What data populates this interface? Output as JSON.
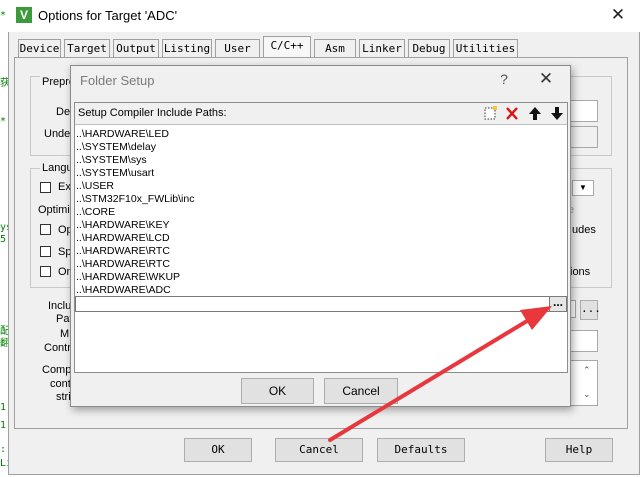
{
  "window": {
    "title": "Options for Target 'ADC'",
    "close_glyph": "✕",
    "icon_letter": "V"
  },
  "tabs": [
    {
      "label": "Device"
    },
    {
      "label": "Target"
    },
    {
      "label": "Output"
    },
    {
      "label": "Listing"
    },
    {
      "label": "User"
    },
    {
      "label": "C/C++"
    },
    {
      "label": "Asm"
    },
    {
      "label": "Linker"
    },
    {
      "label": "Debug"
    },
    {
      "label": "Utilities"
    }
  ],
  "active_tab": "C/C++",
  "background_panel": {
    "preprocessor_label": "Prepro",
    "define_label": "Def",
    "undefine_label": "Undef",
    "language_label": "Langu",
    "execute_label": "Ex",
    "optimize_label": "Optimiz",
    "opt_label": "Op",
    "split_label": "Sp",
    "one_label": "On",
    "dim_e": "e",
    "udes_label": "udes",
    "ions_label": "ions",
    "include_label": "Inclu",
    "paths_label": "Pat",
    "misc_label": "M",
    "controls_label": "Contr",
    "compiler_label": "Comp",
    "control_label": "cont",
    "string_label": "stri",
    "browse_label": "..."
  },
  "bottom_buttons": {
    "ok": "OK",
    "cancel": "Cancel",
    "defaults": "Defaults",
    "help": "Help"
  },
  "folder_setup": {
    "title": "Folder Setup",
    "help_glyph": "?",
    "close_glyph": "✕",
    "header_label": "Setup Compiler Include Paths:",
    "toolbar": {
      "new_icon": "new-folder-icon",
      "delete_icon": "delete-icon",
      "up_icon": "move-up-icon",
      "down_icon": "move-down-icon"
    },
    "paths": [
      "..\\HARDWARE\\LED",
      "..\\SYSTEM\\delay",
      "..\\SYSTEM\\sys",
      "..\\SYSTEM\\usart",
      "..\\USER",
      "..\\STM32F10x_FWLib\\inc",
      "..\\CORE",
      "..\\HARDWARE\\KEY",
      "..\\HARDWARE\\LCD",
      "..\\HARDWARE\\RTC",
      "..\\HARDWARE\\RTC",
      "..\\HARDWARE\\WKUP",
      "..\\HARDWARE\\ADC"
    ],
    "edit_value": "",
    "browse_label": "...",
    "ok": "OK",
    "cancel": "Cancel"
  },
  "annotation": {
    "arrow_color": "#e8383d"
  },
  "editor_marks": [
    "*",
    "获",
    "*",
    "ys",
    "5",
    "配",
    "翻",
    "1",
    "1",
    ":",
    "Li"
  ]
}
